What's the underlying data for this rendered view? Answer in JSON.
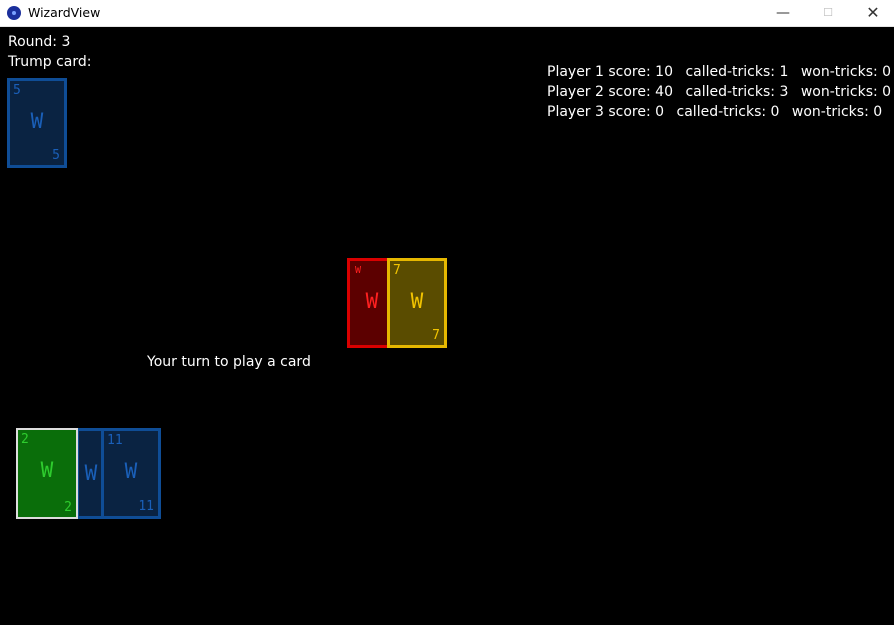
{
  "window": {
    "title": "WizardView",
    "minimize_glyph": "—",
    "maximize_glyph": "☐",
    "close_glyph": "✕"
  },
  "game": {
    "round_label": "Round: 3",
    "trump_label": "Trump card:",
    "turn_message": "Your turn to play a card"
  },
  "scores": [
    {
      "score": "Player 1 score: 10",
      "called": "called-tricks: 1",
      "won": "won-tricks: 0"
    },
    {
      "score": "Player 2 score: 40",
      "called": "called-tricks: 3",
      "won": "won-tricks: 0"
    },
    {
      "score": "Player 3 score: 0",
      "called": "called-tricks: 0",
      "won": "won-tricks: 0"
    }
  ],
  "cards": {
    "trump": {
      "corner_top": "5",
      "center": "W",
      "corner_bottom": "5",
      "color": "blue"
    },
    "played": [
      {
        "corner_top": "W",
        "center": "W",
        "corner_bottom": "",
        "color": "red"
      },
      {
        "corner_top": "7",
        "center": "W",
        "corner_bottom": "7",
        "color": "yellow"
      }
    ],
    "hand": [
      {
        "corner_top": "2",
        "center": "W",
        "corner_bottom": "2",
        "color": "green",
        "selected": true
      },
      {
        "corner_top": "",
        "center": "W",
        "corner_bottom": "",
        "color": "blue"
      },
      {
        "corner_top": "11",
        "center": "W",
        "corner_bottom": "11",
        "color": "blue"
      }
    ]
  }
}
